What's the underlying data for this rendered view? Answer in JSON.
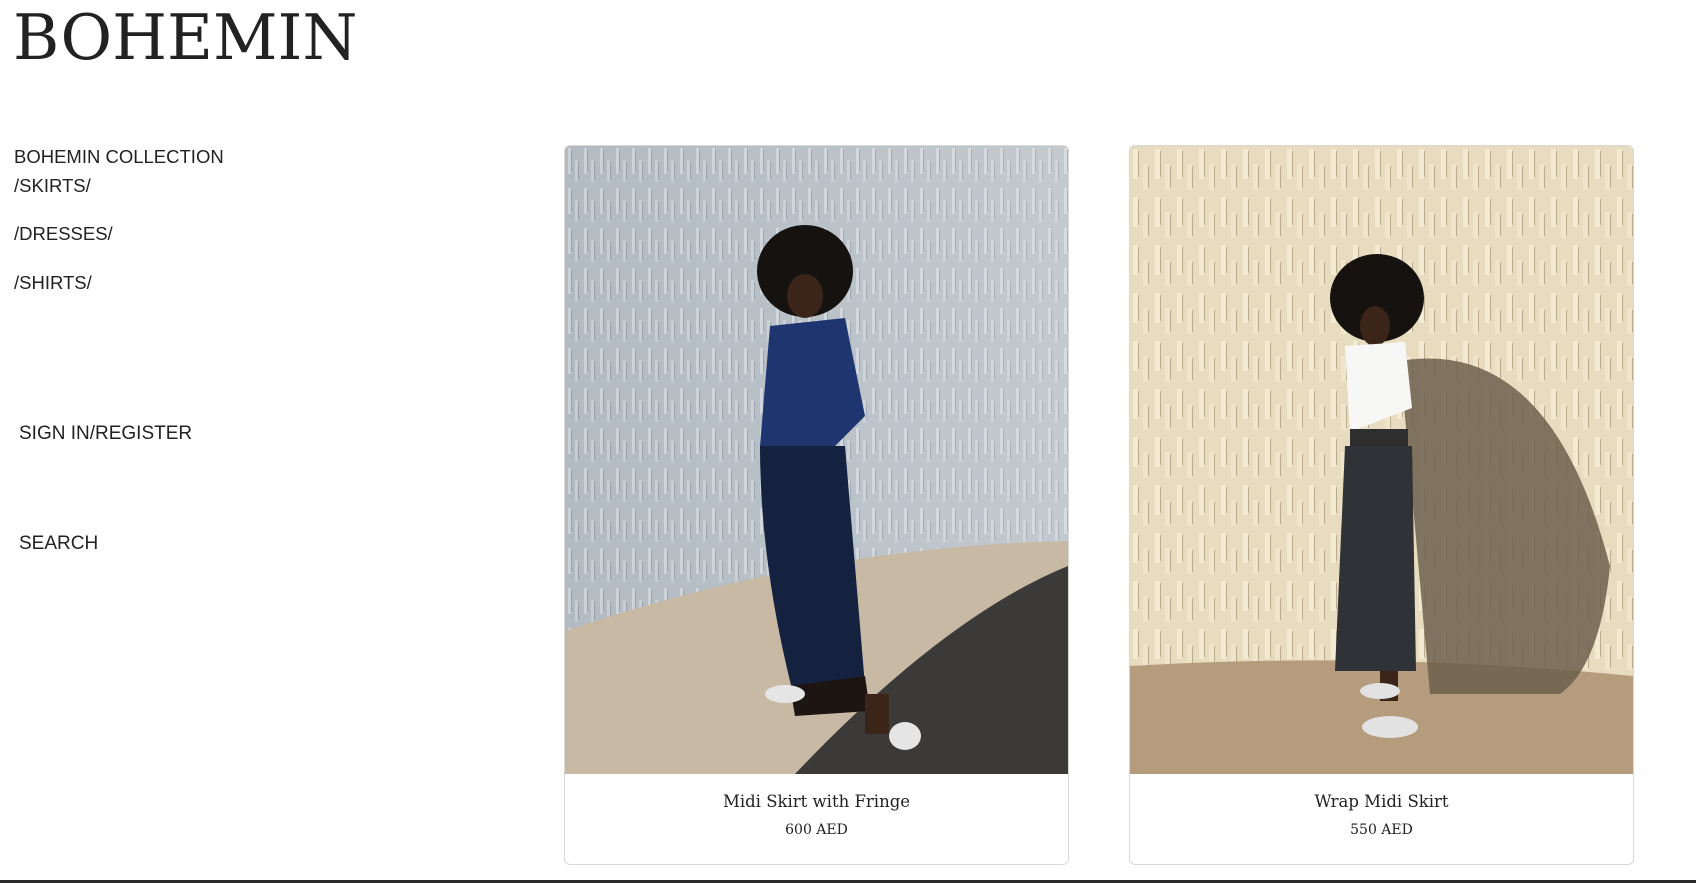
{
  "brand": {
    "logo_text": "BOHEMIN"
  },
  "sidebar": {
    "collection_label": "BOHEMIN COLLECTION",
    "categories": [
      {
        "label": "/SKIRTS/"
      },
      {
        "label": "/DRESSES/"
      },
      {
        "label": "/SHIRTS/"
      }
    ],
    "signin_label": "SIGN IN/REGISTER",
    "search_label": "SEARCH"
  },
  "products": [
    {
      "name": "Midi Skirt with Fringe",
      "price": "600 AED",
      "image_subject": "model in navy satin shirt and fringed midi skirt against grey textured wall"
    },
    {
      "name": "Wrap Midi Skirt",
      "price": "550 AED",
      "image_subject": "model in white tee and dark leather wrap midi skirt against cream textured wall"
    }
  ],
  "colors": {
    "text": "#222222",
    "background": "#ffffff",
    "card_border": "#d8d8d8"
  }
}
